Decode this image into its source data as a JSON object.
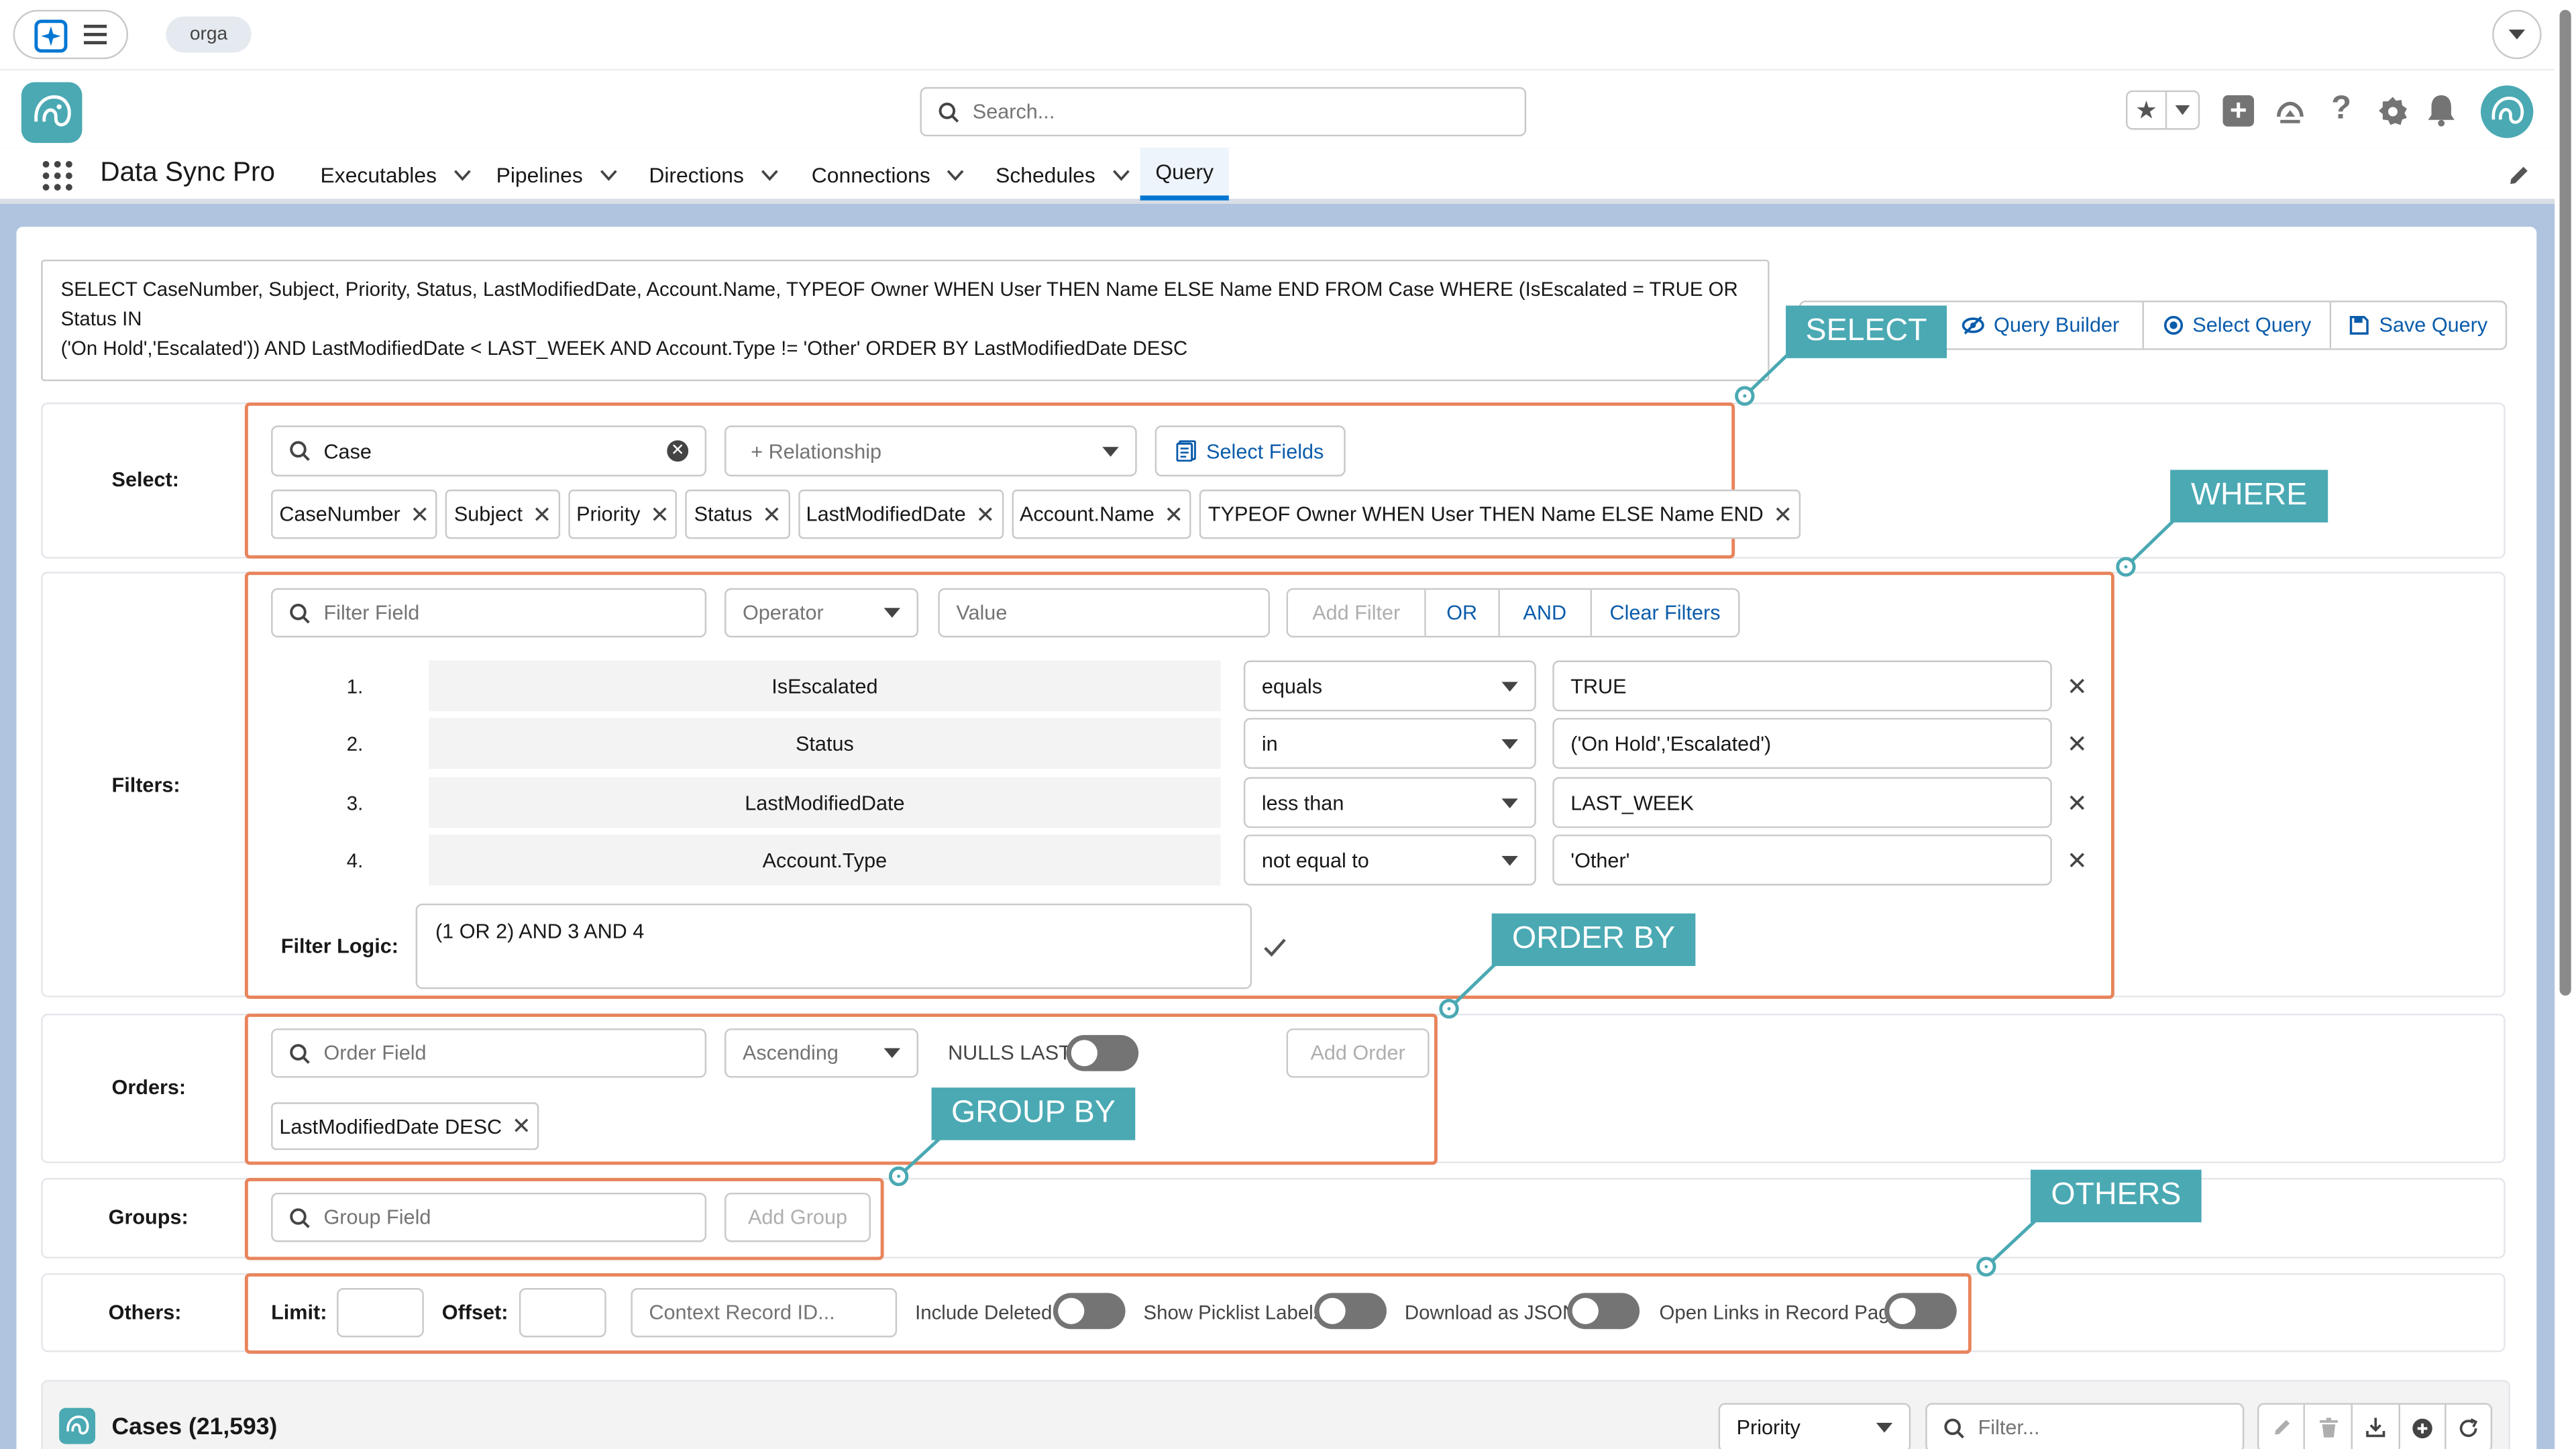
{
  "utility": {
    "org_label": "orga"
  },
  "header": {
    "search_placeholder": "Search..."
  },
  "nav": {
    "app_name": "Data Sync Pro",
    "items": [
      "Executables",
      "Pipelines",
      "Directions",
      "Connections",
      "Schedules"
    ],
    "active_item": "Query"
  },
  "query": {
    "soql_line1": "SELECT CaseNumber, Subject, Priority, Status, LastModifiedDate, Account.Name, TYPEOF Owner WHEN User THEN Name ELSE Name END FROM Case WHERE (IsEscalated = TRUE OR Status IN",
    "soql_line2": "('On Hold','Escalated')) AND LastModifiedDate < LAST_WEEK AND Account.Type != 'Other' ORDER BY LastModifiedDate DESC",
    "query_builder_label": "Query Builder",
    "select_query_label": "Select Query",
    "save_query_label": "Save Query"
  },
  "select": {
    "label": "Select:",
    "object_value": "Case",
    "relationship_placeholder": "+ Relationship",
    "select_fields_label": "Select Fields",
    "chips": [
      "CaseNumber",
      "Subject",
      "Priority",
      "Status",
      "LastModifiedDate",
      "Account.Name",
      "TYPEOF Owner WHEN User THEN Name ELSE Name END"
    ]
  },
  "filters": {
    "label": "Filters:",
    "field_placeholder": "Filter Field",
    "operator_placeholder": "Operator",
    "value_placeholder": "Value",
    "add_filter_label": "Add Filter",
    "or_label": "OR",
    "and_label": "AND",
    "clear_label": "Clear Filters",
    "rows": [
      {
        "num": "1.",
        "field": "IsEscalated",
        "operator": "equals",
        "value": "TRUE"
      },
      {
        "num": "2.",
        "field": "Status",
        "operator": "in",
        "value": "('On Hold','Escalated')"
      },
      {
        "num": "3.",
        "field": "LastModifiedDate",
        "operator": "less than",
        "value": "LAST_WEEK"
      },
      {
        "num": "4.",
        "field": "Account.Type",
        "operator": "not equal to",
        "value": "'Other'"
      }
    ],
    "logic_label": "Filter Logic:",
    "logic_value": "(1 OR 2) AND 3 AND 4"
  },
  "orders": {
    "label": "Orders:",
    "field_placeholder": "Order Field",
    "direction_value": "Ascending",
    "nulls_last_label": "NULLS LAST?",
    "add_order_label": "Add Order",
    "chips": [
      "LastModifiedDate DESC"
    ]
  },
  "groups": {
    "label": "Groups:",
    "field_placeholder": "Group Field",
    "add_group_label": "Add Group"
  },
  "others": {
    "label": "Others:",
    "limit_label": "Limit:",
    "offset_label": "Offset:",
    "context_placeholder": "Context Record ID...",
    "include_deleted_label": "Include Deleted",
    "show_picklist_label": "Show Picklist Labels",
    "download_json_label": "Download as JSON",
    "open_links_label": "Open Links in Record Page"
  },
  "callouts": {
    "select": "SELECT",
    "where": "WHERE",
    "order_by": "ORDER BY",
    "group_by": "GROUP BY",
    "others": "OTHERS"
  },
  "results": {
    "title": "Cases (21,593)",
    "sort_value": "Priority",
    "filter_placeholder": "Filter..."
  },
  "colors": {
    "accent": "#0b5cab",
    "highlight": "#e8845c",
    "callout": "#4aa9b3",
    "background": "#b0c4df"
  }
}
